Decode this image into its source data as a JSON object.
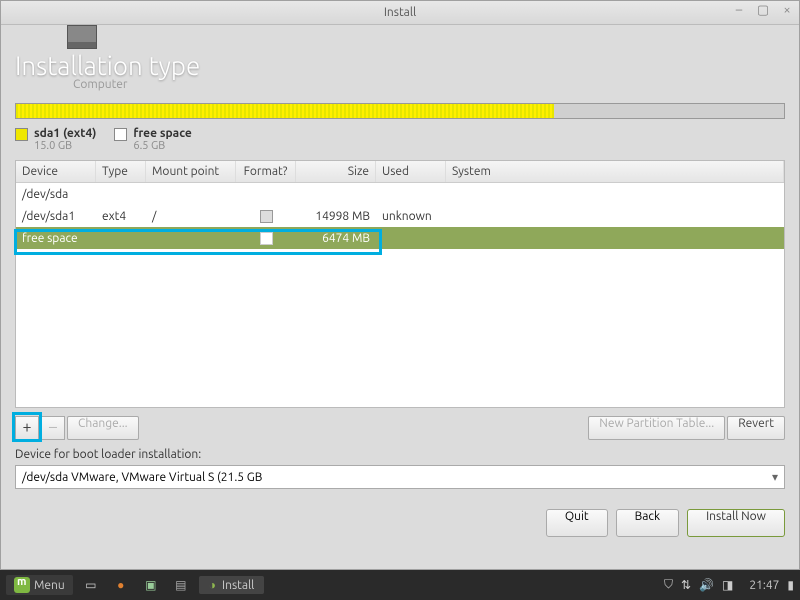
{
  "window": {
    "title": "Install"
  },
  "header": {
    "title": "Installation type",
    "subtitle": "Computer"
  },
  "legend": {
    "sda1_label": "sda1 (ext4)",
    "sda1_size": "15.0 GB",
    "free_label": "free space",
    "free_size": "6.5 GB"
  },
  "table": {
    "columns": {
      "device": "Device",
      "type": "Type",
      "mount": "Mount point",
      "format": "Format?",
      "size": "Size",
      "used": "Used",
      "system": "System"
    },
    "rows": [
      {
        "device": "/dev/sda",
        "type": "",
        "mount": "",
        "format": "",
        "size": "",
        "used": "",
        "system": ""
      },
      {
        "device": "/dev/sda1",
        "type": "ext4",
        "mount": "/",
        "format": "chk",
        "size": "14998 MB",
        "used": "unknown",
        "system": ""
      },
      {
        "device": "free space",
        "type": "",
        "mount": "",
        "format": "chk",
        "size": "6474 MB",
        "used": "",
        "system": ""
      }
    ]
  },
  "toolbar": {
    "add": "+",
    "remove": "–",
    "change": "Change...",
    "new_table": "New Partition Table...",
    "revert": "Revert"
  },
  "bootloader": {
    "label": "Device for boot loader installation:",
    "value": "/dev/sda   VMware, VMware Virtual S (21.5 GB"
  },
  "footer": {
    "quit": "Quit",
    "back": "Back",
    "install": "Install Now"
  },
  "taskbar": {
    "menu": "Menu",
    "task": "Install",
    "time": "21:47"
  }
}
